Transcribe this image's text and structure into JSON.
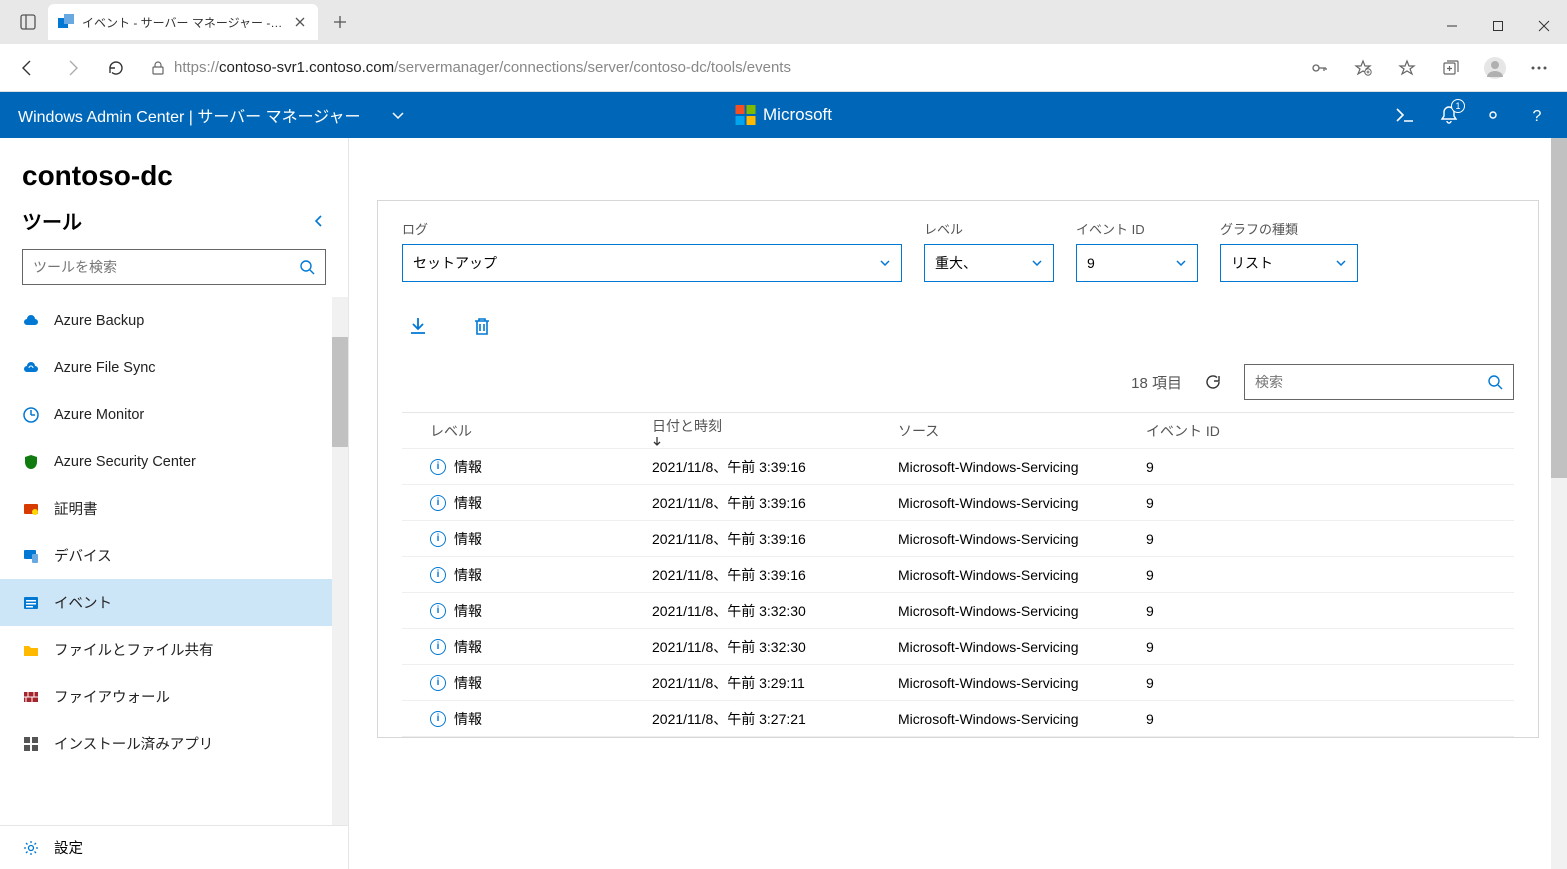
{
  "browser": {
    "tab_title": "イベント - サーバー マネージャー - Windo",
    "url_protocol": "https://",
    "url_host": "contoso-svr1.contoso.com",
    "url_path": "/servermanager/connections/server/contoso-dc/tools/events"
  },
  "header": {
    "brand": "Windows Admin Center",
    "section": "サーバー マネージャー",
    "microsoft": "Microsoft",
    "notification_count": "1"
  },
  "server_name": "contoso-dc",
  "sidebar": {
    "title": "ツール",
    "search_ph": "ツールを検索",
    "items": [
      {
        "label": "Azure Backup",
        "icon": "cloud",
        "color": "#0078d4"
      },
      {
        "label": "Azure File Sync",
        "icon": "sync",
        "color": "#0078d4"
      },
      {
        "label": "Azure Monitor",
        "icon": "monitor",
        "color": "#0078d4"
      },
      {
        "label": "Azure Security Center",
        "icon": "shield",
        "color": "#107c10"
      },
      {
        "label": "証明書",
        "icon": "cert",
        "color": "#d83b01"
      },
      {
        "label": "デバイス",
        "icon": "device",
        "color": "#0078d4"
      },
      {
        "label": "イベント",
        "icon": "events",
        "color": "#0078d4",
        "active": true
      },
      {
        "label": "ファイルとファイル共有",
        "icon": "folder",
        "color": "#ffb900"
      },
      {
        "label": "ファイアウォール",
        "icon": "firewall",
        "color": "#a4262c"
      },
      {
        "label": "インストール済みアプリ",
        "icon": "apps",
        "color": "#555"
      }
    ],
    "settings": "設定"
  },
  "filters": {
    "log_label": "ログ",
    "log_value": "セットアップ",
    "level_label": "レベル",
    "level_value": "重大、",
    "id_label": "イベント ID",
    "id_value": "9",
    "chart_label": "グラフの種類",
    "chart_value": "リスト"
  },
  "results": {
    "count": "18 項目",
    "search_ph": "検索",
    "columns": {
      "level": "レベル",
      "date": "日付と時刻",
      "source": "ソース",
      "id": "イベント ID"
    },
    "rows": [
      {
        "level": "情報",
        "date": "2021/11/8、午前 3:39:16",
        "source": "Microsoft-Windows-Servicing",
        "id": "9"
      },
      {
        "level": "情報",
        "date": "2021/11/8、午前 3:39:16",
        "source": "Microsoft-Windows-Servicing",
        "id": "9"
      },
      {
        "level": "情報",
        "date": "2021/11/8、午前 3:39:16",
        "source": "Microsoft-Windows-Servicing",
        "id": "9"
      },
      {
        "level": "情報",
        "date": "2021/11/8、午前 3:39:16",
        "source": "Microsoft-Windows-Servicing",
        "id": "9"
      },
      {
        "level": "情報",
        "date": "2021/11/8、午前 3:32:30",
        "source": "Microsoft-Windows-Servicing",
        "id": "9"
      },
      {
        "level": "情報",
        "date": "2021/11/8、午前 3:32:30",
        "source": "Microsoft-Windows-Servicing",
        "id": "9"
      },
      {
        "level": "情報",
        "date": "2021/11/8、午前 3:29:11",
        "source": "Microsoft-Windows-Servicing",
        "id": "9"
      },
      {
        "level": "情報",
        "date": "2021/11/8、午前 3:27:21",
        "source": "Microsoft-Windows-Servicing",
        "id": "9"
      }
    ]
  }
}
